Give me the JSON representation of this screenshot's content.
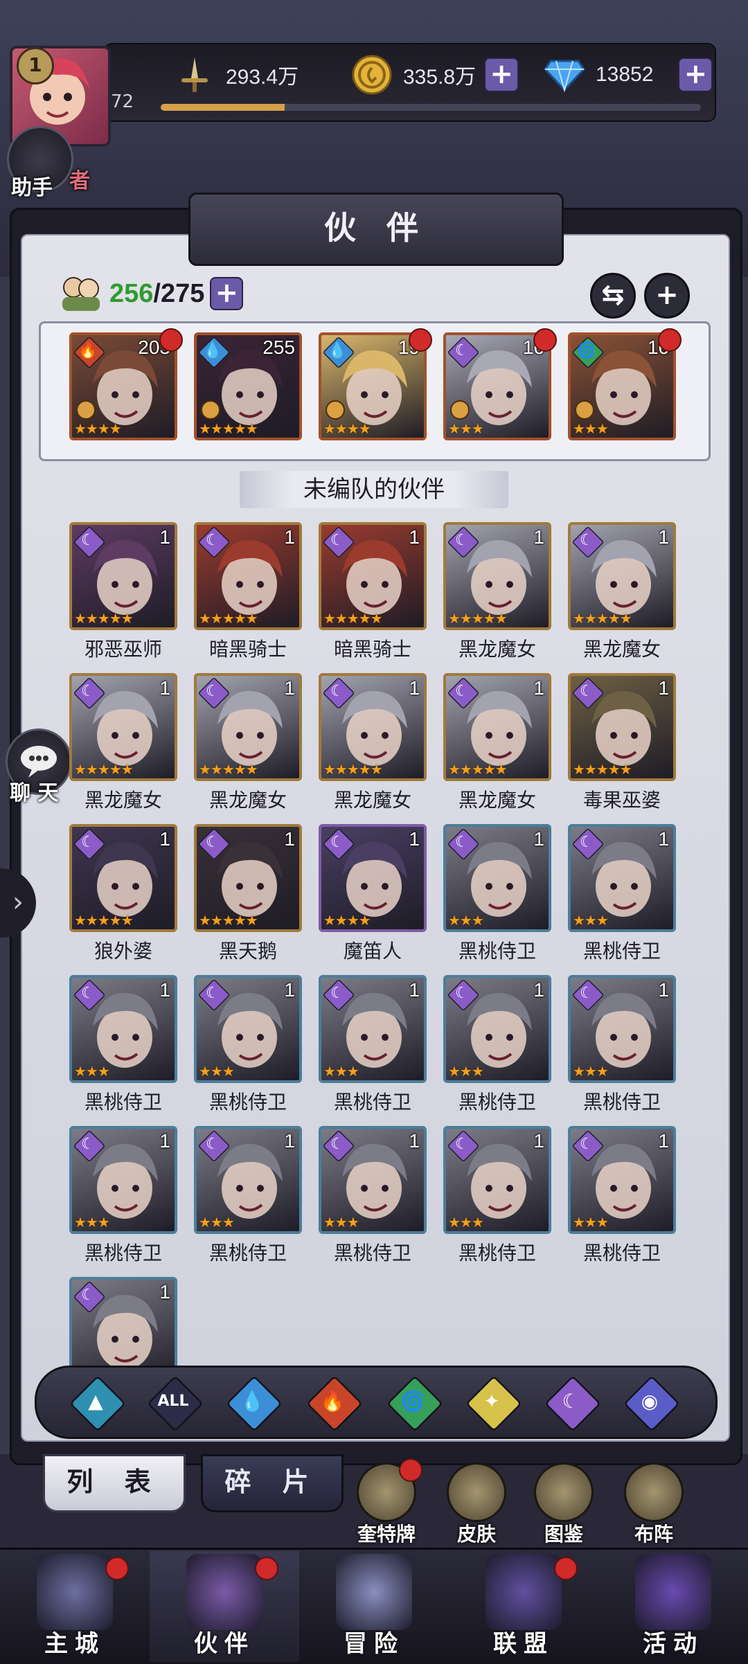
{
  "header": {
    "player_level": "1",
    "xp_text": "72",
    "xp_fraction": 0.23,
    "combat_power": "293.4万",
    "gold": "335.8万",
    "diamonds": "13852"
  },
  "side": {
    "assistant_label": "助手",
    "chat_label": "聊 天",
    "hero_tag": "者"
  },
  "page": {
    "title": "伙 伴",
    "owned": "256",
    "capacity": "/275",
    "section_title": "未编队的伙伴"
  },
  "team": [
    {
      "level": "203",
      "element": "fire",
      "stars": "★★★★",
      "rank": true,
      "dot": true,
      "frame": "red",
      "face": "#7a4a36"
    },
    {
      "level": "255",
      "element": "water",
      "stars": "★★★★★",
      "rank": true,
      "dot": false,
      "frame": "red",
      "face": "#3a2436"
    },
    {
      "level": "19",
      "element": "water",
      "stars": "★★★★",
      "rank": true,
      "dot": true,
      "frame": "red",
      "face": "#d9b66a"
    },
    {
      "level": "16",
      "element": "dark",
      "stars": "★★★",
      "rank": true,
      "dot": true,
      "frame": "red",
      "face": "#a9a9b6"
    },
    {
      "level": "16",
      "element": "wind",
      "stars": "★★★",
      "rank": true,
      "dot": true,
      "frame": "red",
      "face": "#8a5236"
    }
  ],
  "roster": [
    {
      "name": "邪恶巫师",
      "level": "1",
      "element": "dark",
      "stars": "★★★★★",
      "frame": "gold",
      "face": "#5d3b63"
    },
    {
      "name": "暗黑骑士",
      "level": "1",
      "element": "dark",
      "stars": "★★★★★",
      "frame": "gold",
      "face": "#9a3b2e"
    },
    {
      "name": "暗黑骑士",
      "level": "1",
      "element": "dark",
      "stars": "★★★★★",
      "frame": "gold",
      "face": "#9a3b2e"
    },
    {
      "name": "黑龙魔女",
      "level": "1",
      "element": "dark",
      "stars": "★★★★★",
      "frame": "gold",
      "face": "#a3a3b0"
    },
    {
      "name": "黑龙魔女",
      "level": "1",
      "element": "dark",
      "stars": "★★★★★",
      "frame": "gold",
      "face": "#a3a3b0"
    },
    {
      "name": "黑龙魔女",
      "level": "1",
      "element": "dark",
      "stars": "★★★★★",
      "frame": "gold",
      "face": "#a3a3b0"
    },
    {
      "name": "黑龙魔女",
      "level": "1",
      "element": "dark",
      "stars": "★★★★★",
      "frame": "gold",
      "face": "#a3a3b0"
    },
    {
      "name": "黑龙魔女",
      "level": "1",
      "element": "dark",
      "stars": "★★★★★",
      "frame": "gold",
      "face": "#a3a3b0"
    },
    {
      "name": "黑龙魔女",
      "level": "1",
      "element": "dark",
      "stars": "★★★★★",
      "frame": "gold",
      "face": "#a3a3b0"
    },
    {
      "name": "毒果巫婆",
      "level": "1",
      "element": "dark",
      "stars": "★★★★★",
      "frame": "gold",
      "face": "#6e6044"
    },
    {
      "name": "狼外婆",
      "level": "1",
      "element": "dark",
      "stars": "★★★★★",
      "frame": "gold",
      "face": "#3f3650"
    },
    {
      "name": "黑天鹅",
      "level": "1",
      "element": "dark",
      "stars": "★★★★★",
      "frame": "gold",
      "face": "#3a3038"
    },
    {
      "name": "魔笛人",
      "level": "1",
      "element": "dark",
      "stars": "★★★★",
      "frame": "purple",
      "face": "#4a3f63"
    },
    {
      "name": "黑桃侍卫",
      "level": "1",
      "element": "dark",
      "stars": "★★★",
      "frame": "blue",
      "face": "#7c7c88"
    },
    {
      "name": "黑桃侍卫",
      "level": "1",
      "element": "dark",
      "stars": "★★★",
      "frame": "blue",
      "face": "#7c7c88"
    },
    {
      "name": "黑桃侍卫",
      "level": "1",
      "element": "dark",
      "stars": "★★★",
      "frame": "blue",
      "face": "#7c7c88"
    },
    {
      "name": "黑桃侍卫",
      "level": "1",
      "element": "dark",
      "stars": "★★★",
      "frame": "blue",
      "face": "#7c7c88"
    },
    {
      "name": "黑桃侍卫",
      "level": "1",
      "element": "dark",
      "stars": "★★★",
      "frame": "blue",
      "face": "#7c7c88"
    },
    {
      "name": "黑桃侍卫",
      "level": "1",
      "element": "dark",
      "stars": "★★★",
      "frame": "blue",
      "face": "#7c7c88"
    },
    {
      "name": "黑桃侍卫",
      "level": "1",
      "element": "dark",
      "stars": "★★★",
      "frame": "blue",
      "face": "#7c7c88"
    },
    {
      "name": "黑桃侍卫",
      "level": "1",
      "element": "dark",
      "stars": "★★★",
      "frame": "blue",
      "face": "#7c7c88"
    },
    {
      "name": "黑桃侍卫",
      "level": "1",
      "element": "dark",
      "stars": "★★★",
      "frame": "blue",
      "face": "#7c7c88"
    },
    {
      "name": "黑桃侍卫",
      "level": "1",
      "element": "dark",
      "stars": "★★★",
      "frame": "blue",
      "face": "#7c7c88"
    },
    {
      "name": "黑桃侍卫",
      "level": "1",
      "element": "dark",
      "stars": "★★★",
      "frame": "blue",
      "face": "#7c7c88"
    },
    {
      "name": "黑桃侍卫",
      "level": "1",
      "element": "dark",
      "stars": "★★★",
      "frame": "blue",
      "face": "#7c7c88"
    },
    {
      "name": "",
      "level": "1",
      "element": "dark",
      "stars": "",
      "frame": "blue",
      "face": "#7c7c88"
    }
  ],
  "filters": [
    {
      "id": "earth",
      "symbol": "▲",
      "color": "#2f8fb0"
    },
    {
      "id": "all",
      "symbol": "ALL",
      "color": "#2c2b48"
    },
    {
      "id": "water",
      "symbol": "💧",
      "color": "#3c8fd6"
    },
    {
      "id": "fire",
      "symbol": "🔥",
      "color": "#c9452a"
    },
    {
      "id": "wind",
      "symbol": "🌀",
      "color": "#36a05a"
    },
    {
      "id": "light",
      "symbol": "✦",
      "color": "#d6c24a"
    },
    {
      "id": "dark",
      "symbol": "☾",
      "color": "#8b5cc8"
    },
    {
      "id": "space",
      "symbol": "◉",
      "color": "#5a5cc8"
    }
  ],
  "tabs": {
    "list": "列 表",
    "shards": "碎 片"
  },
  "tools": [
    {
      "label": "奎特牌",
      "dot": true
    },
    {
      "label": "皮肤",
      "dot": false
    },
    {
      "label": "图鉴",
      "dot": false
    },
    {
      "label": "布阵",
      "dot": false
    }
  ],
  "nav": [
    {
      "label": "主城",
      "dot": true,
      "active": false,
      "color": "#6d6fa0"
    },
    {
      "label": "伙伴",
      "dot": true,
      "active": true,
      "color": "#7b5aa8"
    },
    {
      "label": "冒险",
      "dot": false,
      "active": false,
      "color": "#8a8fc0"
    },
    {
      "label": "联盟",
      "dot": true,
      "active": false,
      "color": "#6050a0"
    },
    {
      "label": "活动",
      "dot": false,
      "active": false,
      "color": "#6a4ab0"
    }
  ],
  "colors": {
    "elements": {
      "fire": "#c9452a",
      "water": "#3c8fd6",
      "dark": "#8b5cc8",
      "wind": "#36a05a"
    },
    "frames": {
      "gold": "#a07a3b",
      "blue": "#4b7e99",
      "purple": "#7d5ca6",
      "red": "#a2512c"
    }
  }
}
